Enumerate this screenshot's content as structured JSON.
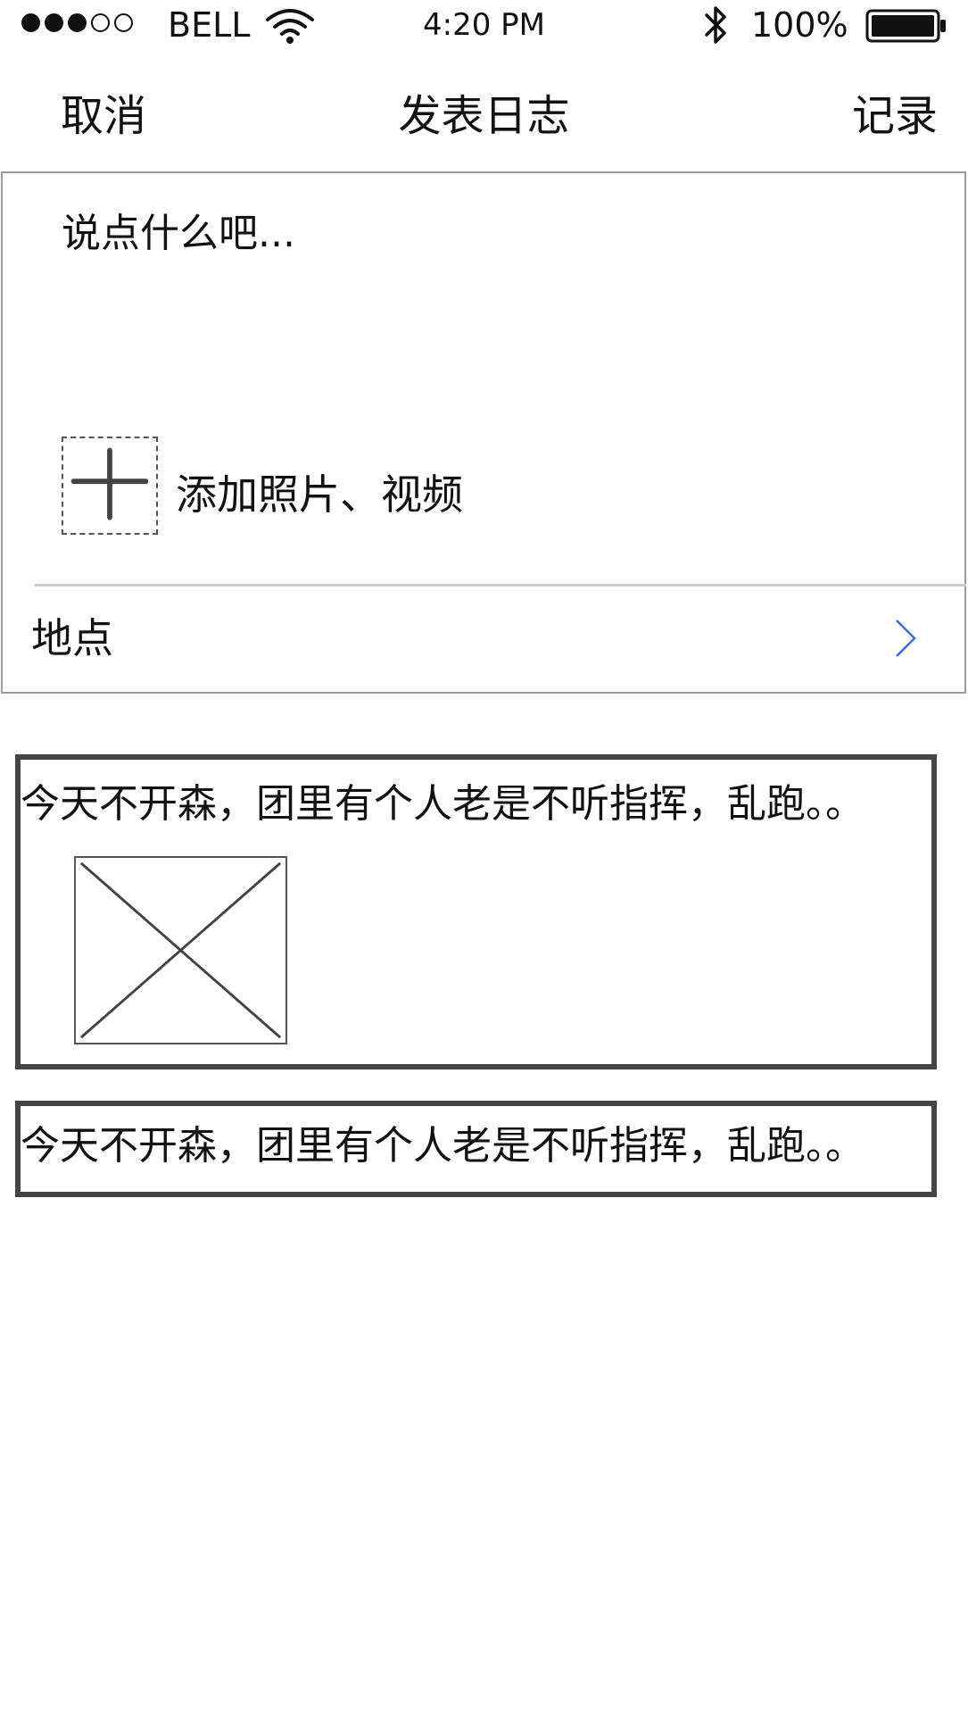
{
  "status_bar": {
    "signal_bars_filled": 3,
    "signal_bars_total": 5,
    "carrier": "BELL",
    "time": "4:20 PM",
    "battery_percent": "100%",
    "icons": [
      "wifi-icon",
      "bluetooth-icon",
      "battery-icon"
    ]
  },
  "nav": {
    "cancel_label": "取消",
    "title": "发表日志",
    "record_label": "记录"
  },
  "compose": {
    "placeholder": "说点什么吧...",
    "value": "",
    "add_media_label": "添加照片、视频",
    "add_media_icon": "plus-icon",
    "location_label": "地点",
    "location_icon": "chevron-right-icon"
  },
  "feed": {
    "posts": [
      {
        "text": "今天不开森，团里有个人老是不听指挥，乱跑。。",
        "has_image": true,
        "image_icon": "image-placeholder-icon"
      },
      {
        "text": "今天不开森，团里有个人老是不听指挥，乱跑。。",
        "has_image": false
      }
    ]
  },
  "colors": {
    "background": "#ffffff",
    "text": "#111111",
    "panel_border": "#9a9a9a",
    "card_border": "#444444",
    "divider": "#cccccc",
    "chevron": "#3a6ed8"
  }
}
